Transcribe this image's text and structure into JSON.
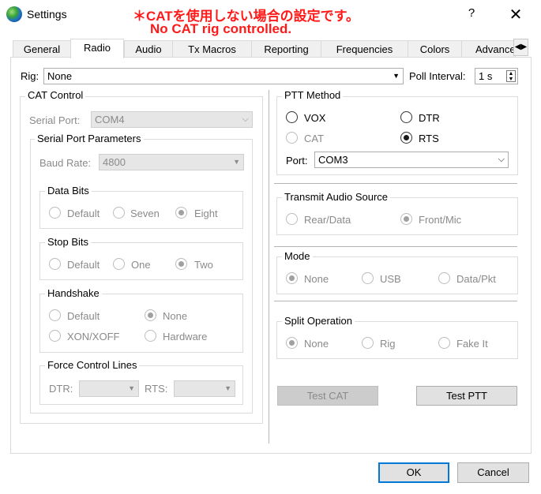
{
  "window": {
    "title": "Settings",
    "help": "?",
    "close": "✕"
  },
  "annotation": {
    "line1": "＊CATを使用しない場合の設定です。",
    "line2": "No CAT rig controlled."
  },
  "tabs": [
    "General",
    "Radio",
    "Audio",
    "Tx Macros",
    "Reporting",
    "Frequencies",
    "Colors",
    "Advanced"
  ],
  "active_tab": "Radio",
  "rig": {
    "label": "Rig:",
    "value": "None"
  },
  "poll": {
    "label": "Poll Interval:",
    "value": "1  s"
  },
  "cat": {
    "title": "CAT Control",
    "serial_port_label": "Serial Port:",
    "serial_port_value": "COM4",
    "spp_title": "Serial Port Parameters",
    "baud_label": "Baud Rate:",
    "baud_value": "4800",
    "data_bits": {
      "title": "Data Bits",
      "options": [
        "Default",
        "Seven",
        "Eight"
      ],
      "selected": "Eight"
    },
    "stop_bits": {
      "title": "Stop Bits",
      "options": [
        "Default",
        "One",
        "Two"
      ],
      "selected": "Two"
    },
    "handshake": {
      "title": "Handshake",
      "options": [
        "Default",
        "None",
        "XON/XOFF",
        "Hardware"
      ],
      "selected": "None"
    },
    "force": {
      "title": "Force Control Lines",
      "dtr_label": "DTR:",
      "rts_label": "RTS:"
    }
  },
  "ptt": {
    "title": "PTT Method",
    "options": [
      "VOX",
      "DTR",
      "CAT",
      "RTS"
    ],
    "selected": "RTS",
    "port_label": "Port:",
    "port_value": "COM3"
  },
  "tx_audio": {
    "title": "Transmit Audio Source",
    "options": [
      "Rear/Data",
      "Front/Mic"
    ],
    "selected": "Front/Mic"
  },
  "mode": {
    "title": "Mode",
    "options": [
      "None",
      "USB",
      "Data/Pkt"
    ],
    "selected": "None"
  },
  "split": {
    "title": "Split Operation",
    "options": [
      "None",
      "Rig",
      "Fake It"
    ],
    "selected": "None"
  },
  "buttons": {
    "test_cat": "Test CAT",
    "test_ptt": "Test PTT",
    "ok": "OK",
    "cancel": "Cancel"
  }
}
